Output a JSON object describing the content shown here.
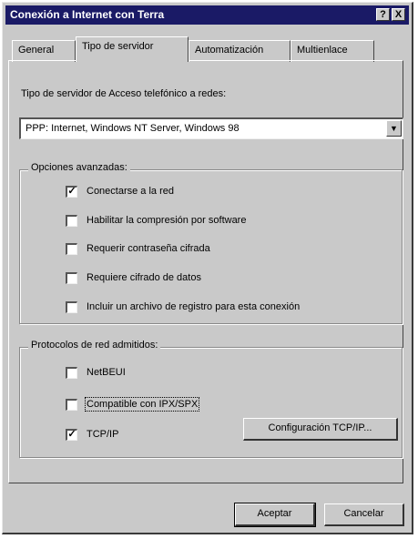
{
  "window": {
    "title": "Conexión a Internet con Terra",
    "help_button": "?",
    "close_button": "X"
  },
  "tabs": [
    {
      "label": "General",
      "active": false
    },
    {
      "label": "Tipo de servidor",
      "active": true
    },
    {
      "label": "Automatización",
      "active": false
    },
    {
      "label": "Multienlace",
      "active": false
    }
  ],
  "server_type": {
    "label": "Tipo de servidor de Acceso telefónico a redes:",
    "value": "PPP: Internet, Windows NT Server, Windows 98"
  },
  "advanced_options": {
    "title": "Opciones avanzadas:",
    "items": [
      {
        "label": "Conectarse a la red",
        "checked": true
      },
      {
        "label": "Habilitar la compresión por software",
        "checked": false
      },
      {
        "label": "Requerir contraseña cifrada",
        "checked": false
      },
      {
        "label": "Requiere cifrado de datos",
        "checked": false
      },
      {
        "label": "Incluir un archivo de registro para esta conexión",
        "checked": false
      }
    ]
  },
  "protocols": {
    "title": "Protocolos de red admitidos:",
    "items": [
      {
        "label": "NetBEUI",
        "checked": false
      },
      {
        "label": "Compatible con IPX/SPX",
        "checked": false,
        "focused": true
      },
      {
        "label": "TCP/IP",
        "checked": true
      }
    ],
    "config_button": "Configuración TCP/IP..."
  },
  "footer": {
    "ok_label": "Aceptar",
    "cancel_label": "Cancelar"
  }
}
